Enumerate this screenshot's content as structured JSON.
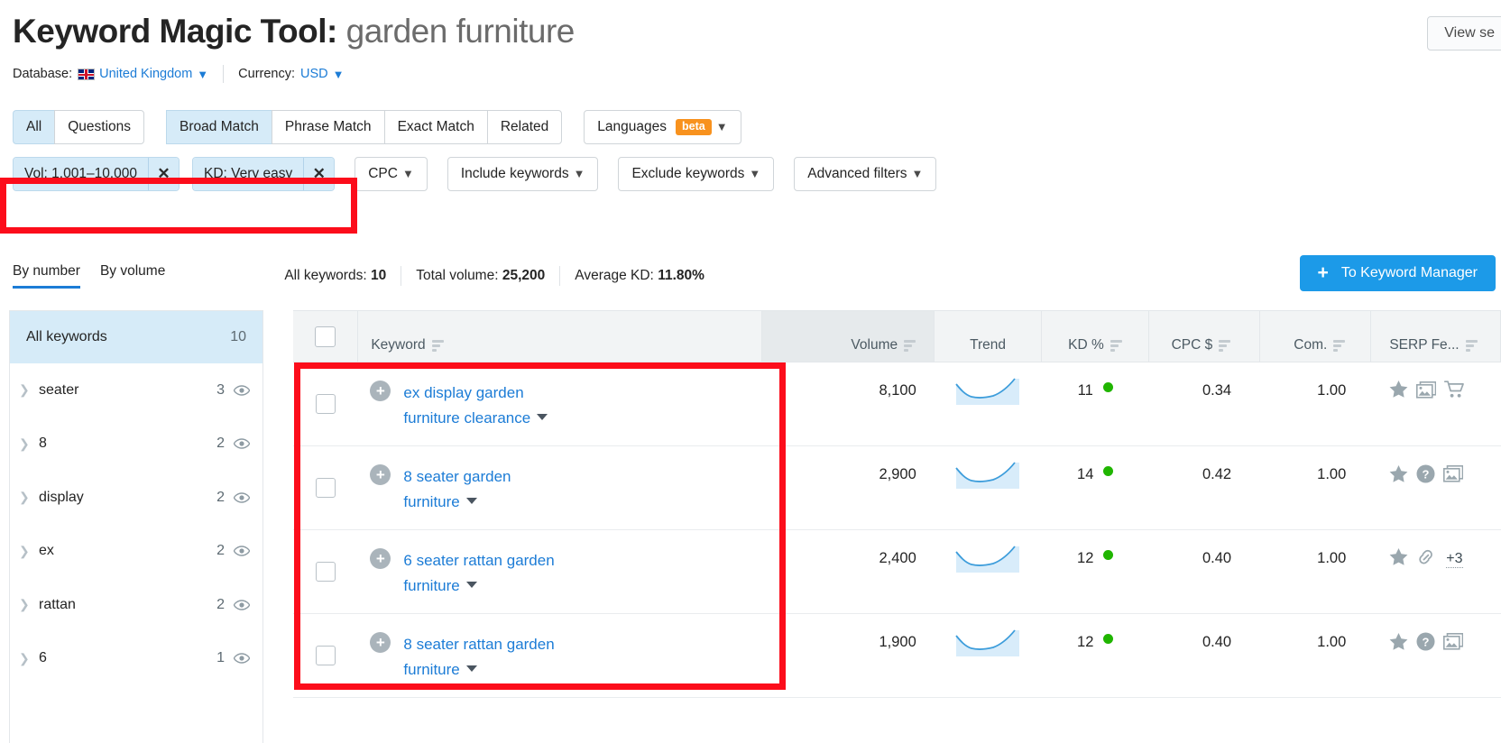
{
  "header": {
    "title_main": "Keyword Magic Tool:",
    "title_term": "garden furniture",
    "database_label": "Database:",
    "database_value": "United Kingdom",
    "currency_label": "Currency:",
    "currency_value": "USD",
    "view_serp_button": "View se"
  },
  "tabs": [
    {
      "label": "All",
      "active": true
    },
    {
      "label": "Questions",
      "active": false
    },
    {
      "label": "Broad Match",
      "active": true
    },
    {
      "label": "Phrase Match",
      "active": false
    },
    {
      "label": "Exact Match",
      "active": false
    },
    {
      "label": "Related",
      "active": false
    }
  ],
  "languages_button": {
    "label": "Languages",
    "badge": "beta"
  },
  "filters": {
    "chips": [
      {
        "label": "Vol: 1,001–10,000",
        "close": "✕"
      },
      {
        "label": "KD: Very easy",
        "close": "✕"
      }
    ],
    "buttons": [
      {
        "label": "CPC"
      },
      {
        "label": "Include keywords"
      },
      {
        "label": "Exclude keywords"
      },
      {
        "label": "Advanced filters"
      }
    ]
  },
  "sortbar": {
    "by_number": "By number",
    "by_volume": "By volume",
    "all_keywords_label": "All keywords:",
    "all_keywords_value": "10",
    "total_volume_label": "Total volume:",
    "total_volume_value": "25,200",
    "average_kd_label": "Average KD:",
    "average_kd_value": "11.80%",
    "keyword_manager_button": "To Keyword Manager",
    "keyword_manager_plus": "+"
  },
  "sidebar": {
    "all": {
      "label": "All keywords",
      "count": "10"
    },
    "items": [
      {
        "label": "seater",
        "count": "3"
      },
      {
        "label": "8",
        "count": "2"
      },
      {
        "label": "display",
        "count": "2"
      },
      {
        "label": "ex",
        "count": "2"
      },
      {
        "label": "rattan",
        "count": "2"
      },
      {
        "label": "6",
        "count": "1"
      }
    ]
  },
  "table": {
    "columns": [
      {
        "label": "Keyword"
      },
      {
        "label": "Volume"
      },
      {
        "label": "Trend"
      },
      {
        "label": "KD %"
      },
      {
        "label": "CPC $"
      },
      {
        "label": "Com."
      },
      {
        "label": "SERP Fe..."
      }
    ],
    "rows": [
      {
        "keyword_line1": "ex display garden",
        "keyword_line2": "furniture clearance",
        "volume": "8,100",
        "kd": "11",
        "cpc": "0.34",
        "com": "1.00",
        "serp_features": [
          "star-icon",
          "images-icon",
          "shopping-cart-icon"
        ],
        "serp_more": ""
      },
      {
        "keyword_line1": "8 seater garden",
        "keyword_line2": "furniture",
        "volume": "2,900",
        "kd": "14",
        "cpc": "0.42",
        "com": "1.00",
        "serp_features": [
          "star-icon",
          "question-icon",
          "images-icon"
        ],
        "serp_more": ""
      },
      {
        "keyword_line1": "6 seater rattan garden",
        "keyword_line2": "furniture",
        "volume": "2,400",
        "kd": "12",
        "cpc": "0.40",
        "com": "1.00",
        "serp_features": [
          "star-icon",
          "link-icon"
        ],
        "serp_more": "+3"
      },
      {
        "keyword_line1": "8 seater rattan garden",
        "keyword_line2": "furniture",
        "volume": "1,900",
        "kd": "12",
        "cpc": "0.40",
        "com": "1.00",
        "serp_features": [
          "star-icon",
          "question-icon",
          "images-icon"
        ],
        "serp_more": ""
      }
    ]
  },
  "colors": {
    "accent_blue": "#1c7cd6",
    "chip_blue": "#d6ebf8",
    "kd_green": "#20b500",
    "beta_orange": "#f8921e",
    "annotation_red": "#fc0d1b",
    "button_blue": "#1c9ae8"
  }
}
